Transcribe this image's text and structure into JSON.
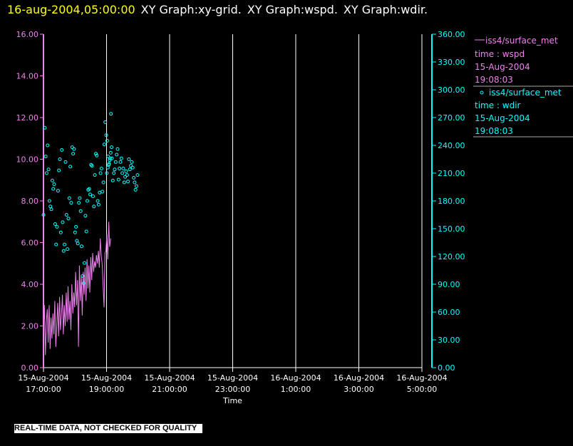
{
  "header": {
    "timestamp": "16-aug-2004,05:00:00",
    "graphs": [
      "XY Graph:xy-grid.",
      "XY Graph:wspd.",
      "XY Graph:wdir."
    ]
  },
  "notice": "REAL-TIME DATA, NOT CHECKED FOR QUALITY",
  "colors": {
    "wspd": "#ee82ee",
    "wdir": "#00ffff",
    "grid": "#ffffff",
    "text": "#ffffff"
  },
  "chart_data": {
    "type": "line",
    "xlabel": "Time",
    "x_ticks": [
      {
        "date": "15-Aug-2004",
        "time": "17:00:00"
      },
      {
        "date": "15-Aug-2004",
        "time": "19:00:00"
      },
      {
        "date": "15-Aug-2004",
        "time": "21:00:00"
      },
      {
        "date": "15-Aug-2004",
        "time": "23:00:00"
      },
      {
        "date": "16-Aug-2004",
        "time": "1:00:00"
      },
      {
        "date": "16-Aug-2004",
        "time": "3:00:00"
      },
      {
        "date": "16-Aug-2004",
        "time": "5:00:00"
      }
    ],
    "x_range_hours": [
      17,
      29
    ],
    "y_left": {
      "range": [
        0,
        16
      ],
      "ticks": [
        "0.00",
        "2.00",
        "4.00",
        "6.00",
        "8.00",
        "10.00",
        "12.00",
        "14.00",
        "16.00"
      ]
    },
    "y_right": {
      "range": [
        0,
        360
      ],
      "ticks": [
        "0.00",
        "30.00",
        "60.00",
        "90.00",
        "120.00",
        "150.00",
        "180.00",
        "210.00",
        "240.00",
        "270.00",
        "300.00",
        "330.00",
        "360.00"
      ]
    },
    "grid": "vertical",
    "legend": [
      {
        "symbol": "line",
        "name": "iss4/surface_met",
        "line2": "time : wspd",
        "line3": "15-Aug-2004",
        "line4": "19:08:03"
      },
      {
        "symbol": "circle",
        "name": "iss4/surface_met",
        "line2": "time : wdir",
        "line3": "15-Aug-2004",
        "line4": "19:08:03"
      }
    ],
    "series": [
      {
        "name": "wspd",
        "axis": "left",
        "style": "line",
        "x": [
          17.0,
          17.03,
          17.06,
          17.09,
          17.12,
          17.15,
          17.18,
          17.21,
          17.24,
          17.27,
          17.3,
          17.33,
          17.36,
          17.39,
          17.42,
          17.45,
          17.48,
          17.51,
          17.54,
          17.57,
          17.6,
          17.63,
          17.66,
          17.69,
          17.72,
          17.75,
          17.78,
          17.81,
          17.84,
          17.87,
          17.9,
          17.93,
          17.96,
          17.99,
          18.02,
          18.05,
          18.08,
          18.11,
          18.14,
          18.17,
          18.2,
          18.23,
          18.26,
          18.29,
          18.32,
          18.35,
          18.38,
          18.41,
          18.44,
          18.47,
          18.5,
          18.53,
          18.56,
          18.59,
          18.62,
          18.65,
          18.68,
          18.71,
          18.74,
          18.77,
          18.8,
          18.83,
          18.86,
          18.89,
          18.92,
          18.95,
          18.98,
          19.01,
          19.04,
          19.07,
          19.1,
          19.13
        ],
        "y": [
          1.8,
          3.0,
          0.6,
          2.2,
          2.8,
          1.2,
          3.0,
          0.9,
          2.4,
          1.4,
          2.6,
          1.6,
          3.2,
          1.0,
          2.0,
          3.1,
          1.5,
          3.4,
          1.8,
          2.5,
          3.5,
          1.6,
          3.0,
          2.0,
          3.6,
          2.2,
          3.9,
          2.3,
          3.2,
          1.8,
          4.0,
          2.6,
          3.6,
          2.9,
          4.6,
          3.0,
          4.2,
          1.0,
          4.9,
          3.2,
          4.4,
          2.5,
          4.6,
          3.5,
          4.8,
          3.2,
          5.2,
          3.8,
          4.9,
          3.6,
          5.3,
          4.2,
          5.5,
          4.6,
          5.1,
          4.8,
          5.4,
          5.0,
          5.6,
          4.8,
          6.2,
          5.4,
          5.0,
          4.0,
          2.9,
          5.5,
          5.6,
          6.4,
          5.2,
          7.0,
          5.8,
          6.2
        ]
      },
      {
        "name": "wdir",
        "axis": "right",
        "style": "circle",
        "x": [
          17.0,
          17.04,
          17.07,
          17.1,
          17.13,
          17.16,
          17.19,
          17.22,
          17.25,
          17.28,
          17.31,
          17.34,
          17.37,
          17.4,
          17.43,
          17.46,
          17.49,
          17.52,
          17.55,
          17.58,
          17.61,
          17.64,
          17.67,
          17.7,
          17.73,
          17.76,
          17.79,
          17.82,
          17.85,
          17.88,
          17.91,
          17.94,
          17.97,
          18.0,
          18.03,
          18.06,
          18.09,
          18.12,
          18.15,
          18.18,
          18.21,
          18.24,
          18.27,
          18.3,
          18.33,
          18.36,
          18.39,
          18.42,
          18.45,
          18.48,
          18.51,
          18.54,
          18.57,
          18.6,
          18.63,
          18.66,
          18.69,
          18.72,
          18.75,
          18.78,
          18.81,
          18.84,
          18.87,
          18.9,
          18.93,
          18.96,
          18.99,
          19.02,
          19.05,
          19.08,
          19.11,
          19.14,
          19.17,
          19.2,
          19.23,
          19.26,
          19.29,
          19.32,
          19.35,
          19.38,
          19.41,
          19.44,
          19.47,
          19.5,
          19.53,
          19.56,
          19.59,
          19.62,
          19.65,
          19.68,
          19.71,
          19.74,
          19.77,
          19.8,
          19.83,
          19.86,
          19.89,
          19.92,
          19.95,
          19.98,
          19.01,
          19.04,
          19.07,
          19.1,
          19.13,
          19.16
        ],
        "y": [
          165,
          259,
          228,
          210,
          240,
          214,
          180,
          174,
          171,
          202,
          193,
          198,
          155,
          133,
          152,
          191,
          213,
          225,
          146,
          235,
          157,
          126,
          133,
          222,
          165,
          128,
          161,
          183,
          217,
          178,
          238,
          231,
          236,
          146,
          152,
          137,
          134,
          178,
          183,
          169,
          131,
          99,
          91,
          113,
          164,
          147,
          180,
          192,
          193,
          187,
          219,
          218,
          185,
          174,
          208,
          231,
          229,
          180,
          176,
          189,
          210,
          215,
          190,
          200,
          241,
          265,
          251,
          245,
          228,
          220,
          226,
          274,
          226,
          202,
          210,
          214,
          222,
          230,
          236,
          203,
          215,
          222,
          226,
          210,
          215,
          200,
          206,
          212,
          208,
          201,
          225,
          214,
          218,
          222,
          216,
          205,
          200,
          192,
          196,
          208,
          210,
          216,
          219,
          224,
          232,
          238
        ]
      }
    ]
  }
}
